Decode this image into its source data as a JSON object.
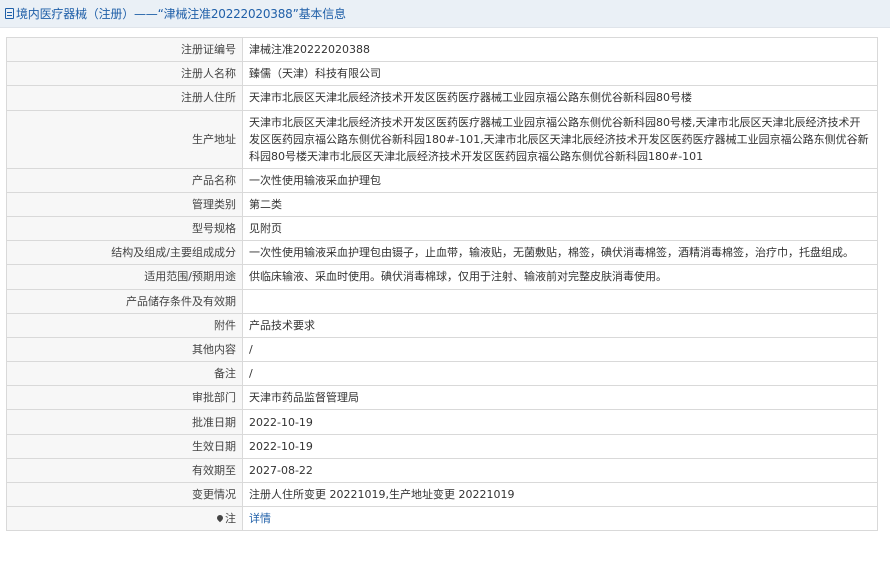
{
  "header": {
    "title": "境内医疗器械（注册）——“津械注准20222020388”基本信息"
  },
  "rows": [
    {
      "label": "注册证编号",
      "value": "津械注准20222020388"
    },
    {
      "label": "注册人名称",
      "value": "臻儒（天津）科技有限公司"
    },
    {
      "label": "注册人住所",
      "value": "天津市北辰区天津北辰经济技术开发区医药医疗器械工业园京福公路东侧优谷新科园80号楼"
    },
    {
      "label": "生产地址",
      "value": "天津市北辰区天津北辰经济技术开发区医药医疗器械工业园京福公路东侧优谷新科园80号楼,天津市北辰区天津北辰经济技术开发区医药园京福公路东侧优谷新科园180#-101,天津市北辰区天津北辰经济技术开发区医药医疗器械工业园京福公路东侧优谷新科园80号楼天津市北辰区天津北辰经济技术开发区医药园京福公路东侧优谷新科园180#-101"
    },
    {
      "label": "产品名称",
      "value": "一次性使用输液采血护理包"
    },
    {
      "label": "管理类别",
      "value": "第二类"
    },
    {
      "label": "型号规格",
      "value": "见附页"
    },
    {
      "label": "结构及组成/主要组成成分",
      "value": "一次性使用输液采血护理包由镊子，止血带，输液贴，无菌敷贴，棉签，碘伏消毒棉签，酒精消毒棉签，治疗巾，托盘组成。"
    },
    {
      "label": "适用范围/预期用途",
      "value": "供临床输液、采血时使用。碘伏消毒棉球，仅用于注射、输液前对完整皮肤消毒使用。"
    },
    {
      "label": "产品储存条件及有效期",
      "value": ""
    },
    {
      "label": "附件",
      "value": "产品技术要求"
    },
    {
      "label": "其他内容",
      "value": "/"
    },
    {
      "label": "备注",
      "value": "/"
    },
    {
      "label": "审批部门",
      "value": "天津市药品监督管理局"
    },
    {
      "label": "批准日期",
      "value": "2022-10-19"
    },
    {
      "label": "生效日期",
      "value": "2022-10-19"
    },
    {
      "label": "有效期至",
      "value": "2027-08-22"
    },
    {
      "label": "变更情况",
      "value": "注册人住所变更 20221019,生产地址变更 20221019"
    }
  ],
  "note": {
    "label": "注",
    "icon": "location-pin-icon",
    "link": "详情"
  }
}
